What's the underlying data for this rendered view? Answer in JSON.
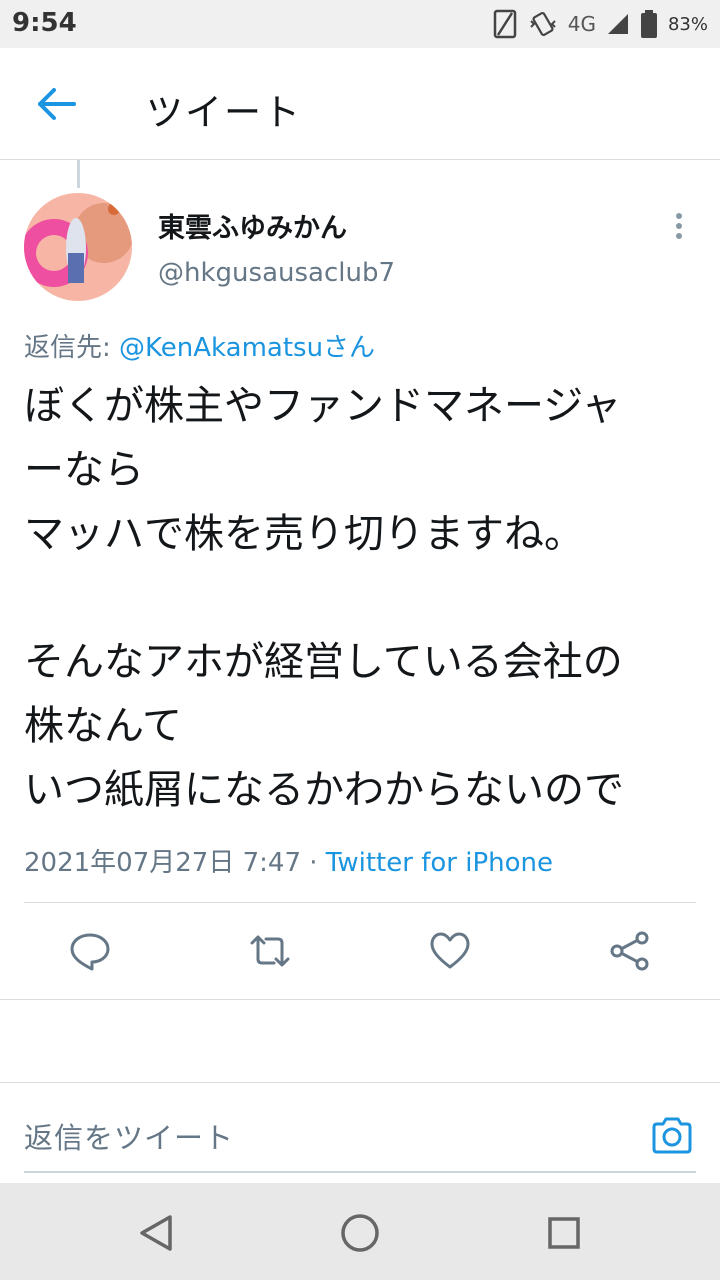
{
  "status_bar": {
    "time": "9:54",
    "network": "4G",
    "battery": "83%"
  },
  "app_bar": {
    "title": "ツイート"
  },
  "tweet": {
    "author_name": "東雲ふゆみかん",
    "author_handle": "@hkgusausaclub7",
    "reply_prefix": "返信先: ",
    "reply_mention": "@KenAkamatsuさん",
    "text_lines": [
      "ぼくが株主やファンドマネージャ",
      "ーなら",
      "マッハで株を売り切りますね。",
      "",
      "そんなアホが経営している会社の",
      "株なんて",
      "いつ紙屑になるかわからないので"
    ],
    "timestamp": "2021年07月27日 7:47",
    "separator": " · ",
    "source": "Twitter for iPhone"
  },
  "composer": {
    "placeholder": "返信をツイート"
  },
  "colors": {
    "accent": "#1b95e0",
    "text": "#14171a",
    "secondary": "#657786"
  }
}
